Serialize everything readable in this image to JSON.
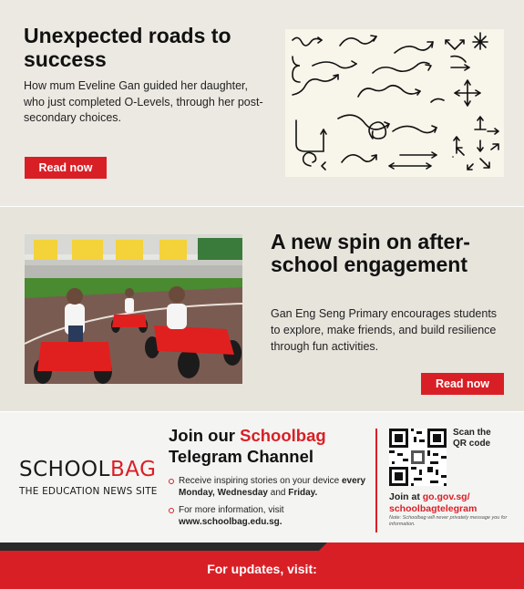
{
  "colors": {
    "accent": "#d91f26",
    "section1_bg": "#ece9e2",
    "section2_bg": "#e7e4dc",
    "section3_bg": "#f4f4f2",
    "dark_bar": "#2a2a2a"
  },
  "article1": {
    "title": "Unexpected roads to success",
    "description": "How mum Eveline Gan guided her daughter, who just completed O-Levels, through her post-secondary choices.",
    "button": "Read now",
    "image_icon": "arrows-doodle-illustration"
  },
  "article2": {
    "title": "A new spin on after-school engagement",
    "description": "Gan Eng Seng Primary encourages students to explore, make friends, and build resilience through fun activities.",
    "button": "Read now",
    "image_icon": "children-on-go-karts-photo"
  },
  "telegram": {
    "logo_main_a": "SCHOOL",
    "logo_main_b": "BAG",
    "logo_sub": "THE EDUCATION NEWS SITE",
    "title_a": "Join our ",
    "title_b": "Schoolbag",
    "title_c": "Telegram Channel",
    "bullet1_a": "Receive inspiring stories on your device ",
    "bullet1_b": "every Monday, Wednesday",
    "bullet1_c": " and ",
    "bullet1_d": "Friday.",
    "bullet2_a": "For more information, visit ",
    "bullet2_b": "www.schoolbag.edu.sg.",
    "scan": "Scan the QR code",
    "join_at": "Join at ",
    "join_link": "go.gov.sg/ schoolbagtelegram",
    "note": "Note: Schoolbag will never privately message you for information.",
    "qr_icon": "qr-code-icon"
  },
  "footer": {
    "text": "For updates, visit:"
  }
}
